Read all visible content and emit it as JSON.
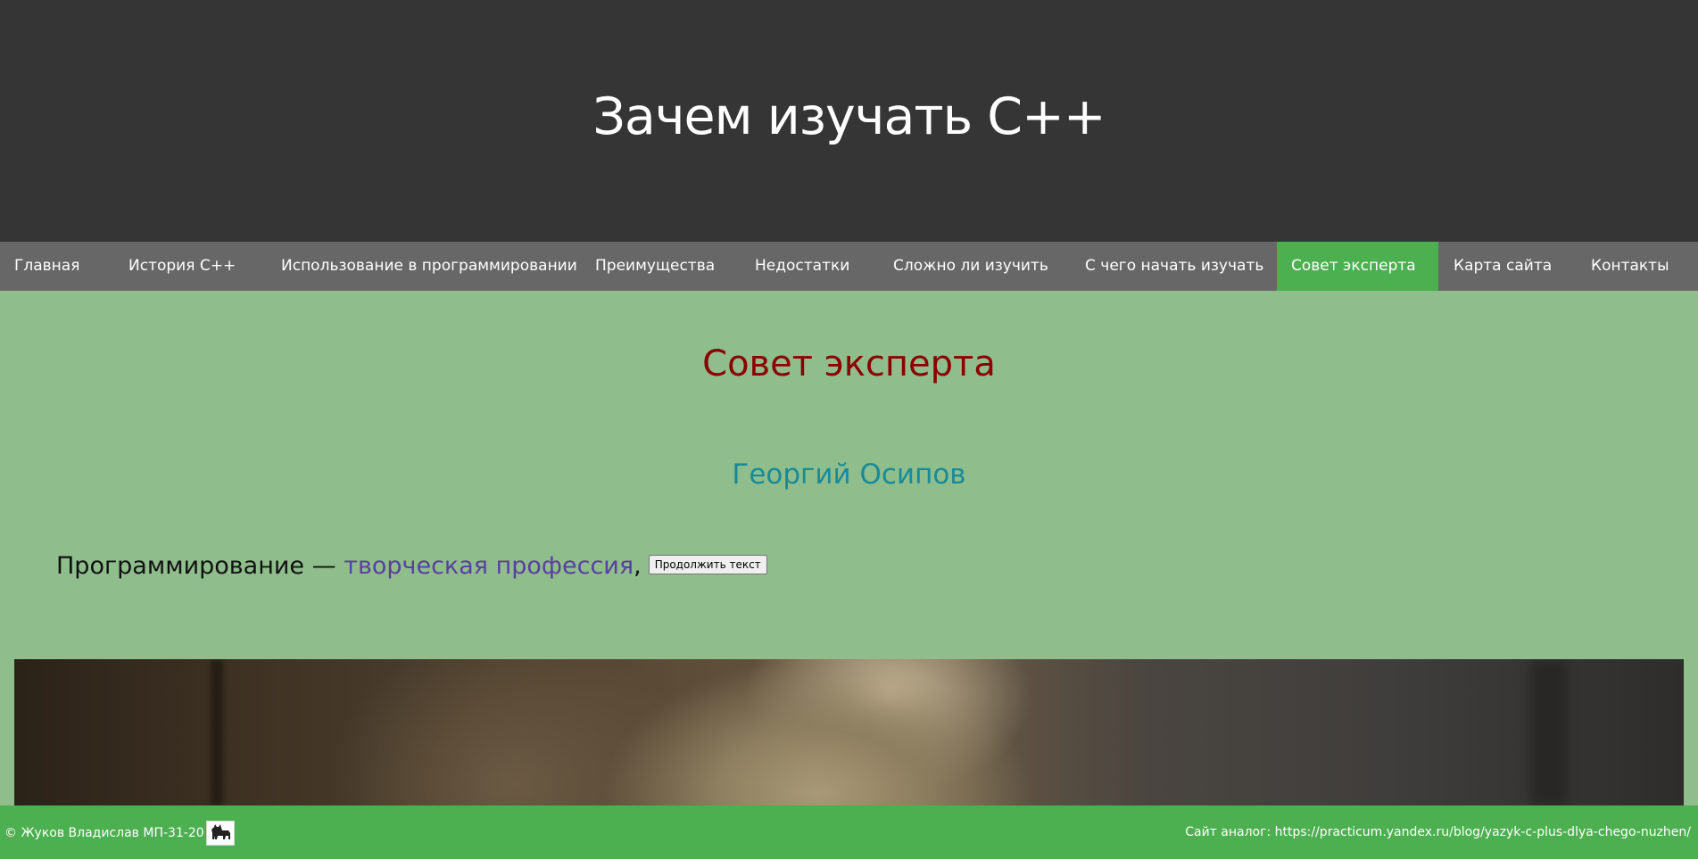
{
  "header": {
    "title": "Зачем изучать С++"
  },
  "nav": {
    "items": [
      {
        "label": "Главная"
      },
      {
        "label": "История С++"
      },
      {
        "label": "Использование в программировании"
      },
      {
        "label": "Преимущества"
      },
      {
        "label": "Недостатки"
      },
      {
        "label": "Сложно ли изучить"
      },
      {
        "label": "С чего начать изучать"
      },
      {
        "label": "Совет эксперта",
        "active": true
      },
      {
        "label": "Карта сайта"
      },
      {
        "label": "Контакты"
      }
    ]
  },
  "main": {
    "title": "Совет эксперта",
    "expert_name": "Георгий Осипов",
    "quote": {
      "lead": "Программирование — ",
      "link": "творческая профессия",
      "trail": ",",
      "button": "Продолжить текст"
    }
  },
  "footer": {
    "copyright": "© Жуков Владислав МП-31-20 id:9",
    "analog_label": "Сайт аналог: ",
    "analog_url": "https://practicum.yandex.ru/blog/yazyk-c-plus-dlya-chego-nuzhen/"
  },
  "colors": {
    "header_bg": "#353535",
    "nav_bg": "#676767",
    "accent": "#4caf50",
    "content_bg": "#8fbe8c",
    "title": "#8b0000",
    "expert": "#1a8a98"
  }
}
